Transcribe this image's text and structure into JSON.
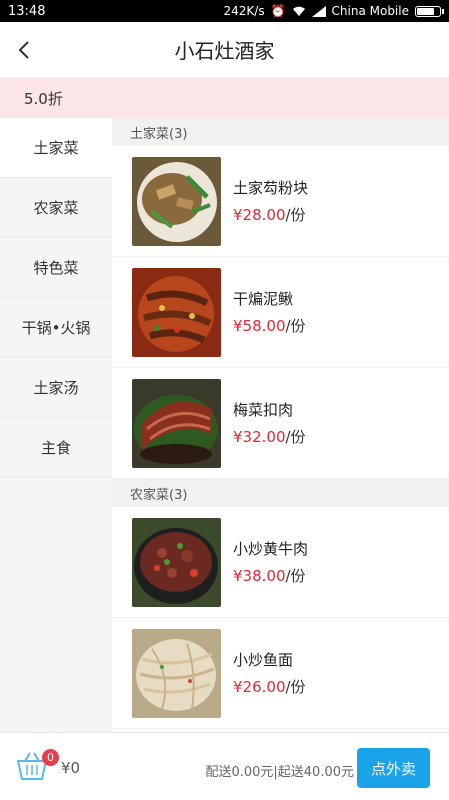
{
  "status": {
    "time": "13:48",
    "speed": "242K/s",
    "carrier": "China Mobile",
    "battery_level": 0.7
  },
  "nav": {
    "title": "小石灶酒家",
    "back_icon": "chevron-left-icon"
  },
  "discount_label": "5.0折",
  "sidebar": {
    "items": [
      {
        "label": "土家菜",
        "active": true
      },
      {
        "label": "农家菜",
        "active": false
      },
      {
        "label": "特色菜",
        "active": false
      },
      {
        "label": "干锅•火锅",
        "active": false
      },
      {
        "label": "土家汤",
        "active": false
      },
      {
        "label": "主食",
        "active": false
      }
    ]
  },
  "sections": [
    {
      "header": "土家菜(3)",
      "dishes": [
        {
          "name": "土家芶粉块",
          "price": "¥28.00",
          "unit": "/份",
          "image": "stir-fried-starch-blocks"
        },
        {
          "name": "干煸泥鳅",
          "price": "¥58.00",
          "unit": "/份",
          "image": "dry-fried-loach"
        },
        {
          "name": "梅菜扣肉",
          "price": "¥32.00",
          "unit": "/份",
          "image": "braised-pork-with-preserved-vegetable"
        }
      ]
    },
    {
      "header": "农家菜(3)",
      "dishes": [
        {
          "name": "小炒黄牛肉",
          "price": "¥38.00",
          "unit": "/份",
          "image": "stir-fried-beef"
        },
        {
          "name": "小炒鱼面",
          "price": "¥26.00",
          "unit": "/份",
          "image": "stir-fried-fish-noodles"
        }
      ]
    }
  ],
  "cart": {
    "icon": "basket-icon",
    "count": "0",
    "total": "¥0"
  },
  "delivery_text": "配送0.00元|起送40.00元",
  "order_button": "点外卖",
  "colors": {
    "accent": "#1aa3e9",
    "price": "#e02a33",
    "discount_bg": "#fbe5e7",
    "badge": "#e8404b"
  }
}
